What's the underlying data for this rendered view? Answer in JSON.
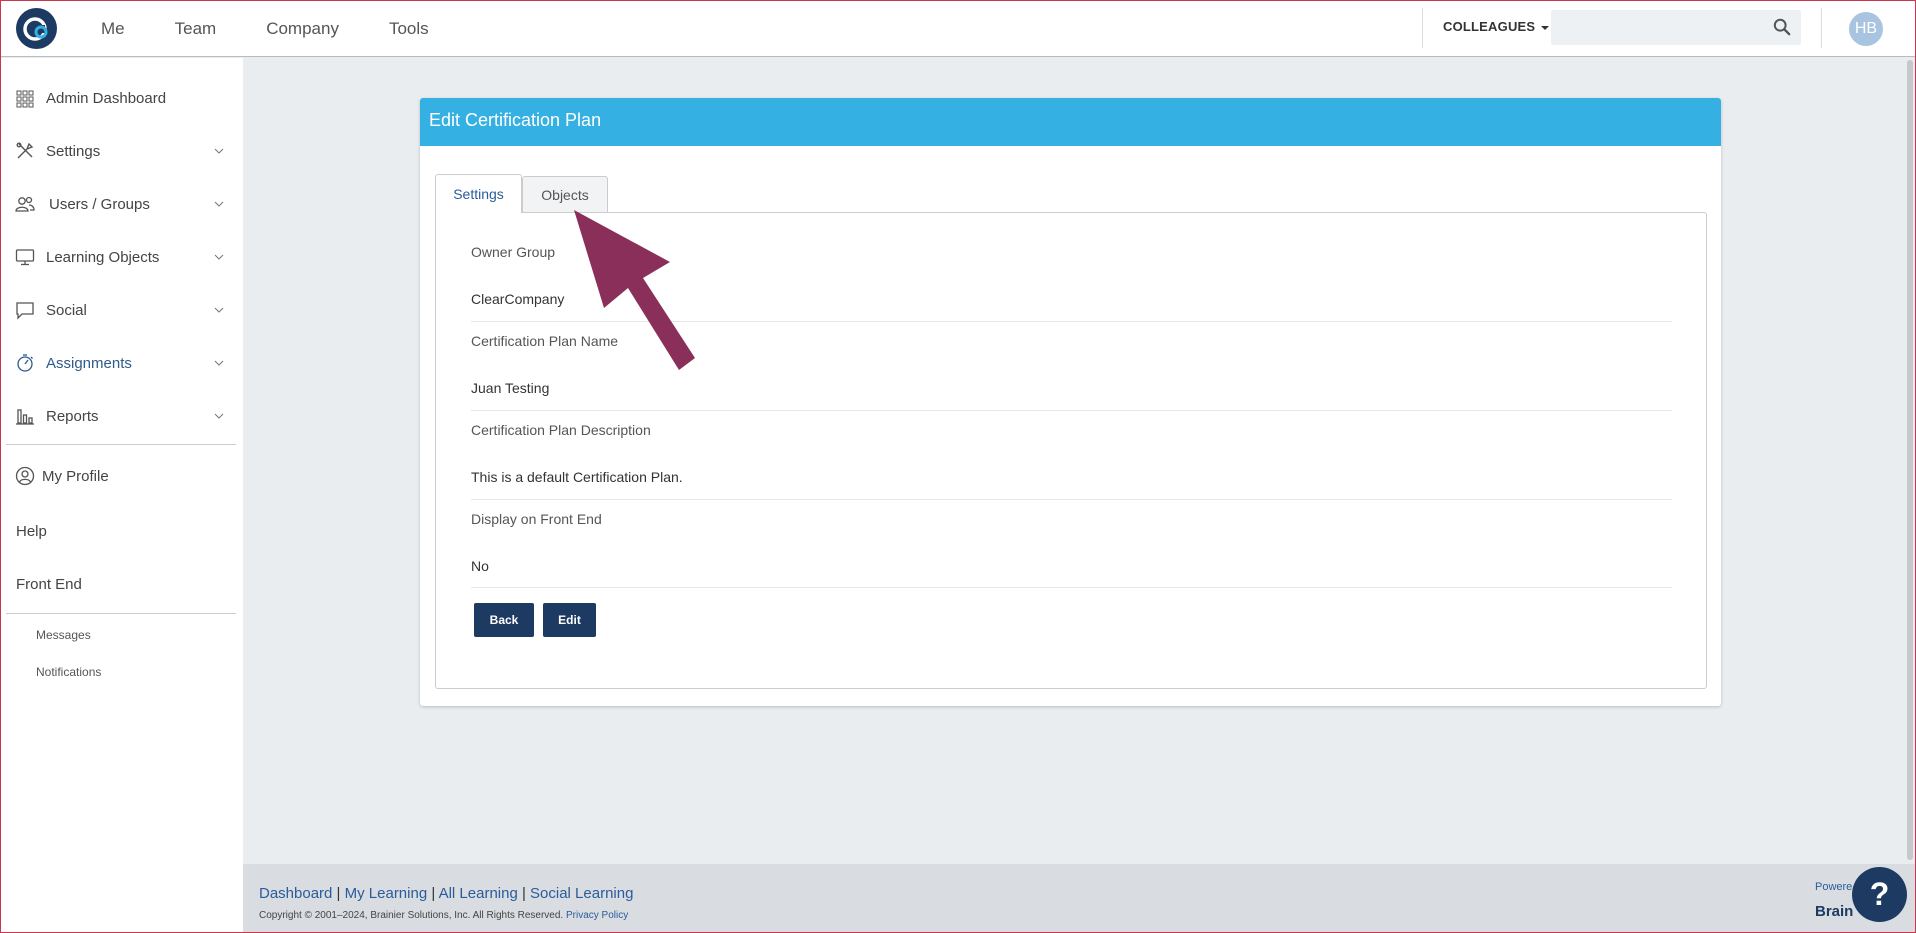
{
  "topnav": {
    "logo_icon": "clearcompany-logo",
    "links": [
      "Me",
      "Team",
      "Company",
      "Tools"
    ],
    "colleagues_label": "COLLEAGUES",
    "search_placeholder": "",
    "search_value": "",
    "avatar_initials": "HB"
  },
  "sidebar": {
    "items": [
      {
        "label": "Admin Dashboard",
        "icon": "grid-icon"
      },
      {
        "label": "Settings",
        "icon": "tools-icon"
      },
      {
        "label": "Users / Groups",
        "icon": "users-icon"
      },
      {
        "label": "Learning Objects",
        "icon": "monitor-icon"
      },
      {
        "label": "Social",
        "icon": "chat-icon"
      },
      {
        "label": "Assignments",
        "icon": "stopwatch-icon",
        "active": true
      },
      {
        "label": "Reports",
        "icon": "bar-chart-icon"
      }
    ],
    "my_profile": "My Profile",
    "help": "Help",
    "front_end": "Front End",
    "messages": "Messages",
    "notifications": "Notifications"
  },
  "card": {
    "title": "Edit Certification Plan",
    "tabs": [
      "Settings",
      "Objects"
    ],
    "fields": [
      {
        "label": "Owner Group",
        "value": "ClearCompany"
      },
      {
        "label": "Certification Plan Name",
        "value": "Juan Testing"
      },
      {
        "label": "Certification Plan Description",
        "value": "This is a default Certification Plan."
      },
      {
        "label": "Display on Front End",
        "value": "No"
      }
    ],
    "back_label": "Back",
    "edit_label": "Edit"
  },
  "footer": {
    "links": [
      "Dashboard",
      "My Learning",
      "All Learning",
      "Social Learning"
    ],
    "copyright": "Copyright © 2001–2024, Brainier Solutions, Inc. All Rights Reserved.",
    "privacy": "Privacy Policy",
    "powered": "Powere",
    "brand": "Brain"
  },
  "help_label": "?",
  "colors": {
    "header_blue": "#35b0e2",
    "navy": "#1d3a63",
    "arrow": "#8a2f5a"
  }
}
